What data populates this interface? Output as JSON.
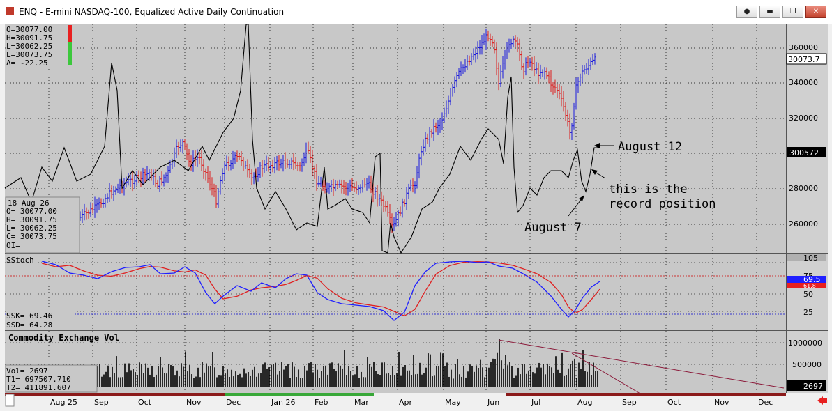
{
  "window": {
    "title": "ENQ - E-mini NASDAQ-100, Equalized Active Daily Continuation",
    "buttons": [
      "●",
      "▬",
      "❐",
      "✕"
    ]
  },
  "ohlc_box": {
    "open": "O=30077.00",
    "high": "H=30091.75",
    "low1": "L=30062.25",
    "low2": "L=30073.75",
    "delta": "Δ=  -22.25"
  },
  "data_window": {
    "date": "18 Aug 26",
    "o": "O=    30077.00",
    "h": "H=    30091.75",
    "l": "L=    30062.25",
    "c": "C=    30073.75",
    "oi": "OI="
  },
  "price_panel": {
    "ticks": [
      "360000",
      "340000",
      "320000",
      "300000",
      "280000",
      "260000"
    ],
    "last_price": "30073.7",
    "line_marker": "300572"
  },
  "annotations": {
    "aug12": "August 12",
    "record1": "this is the",
    "record2": "record position",
    "aug7": "August 7"
  },
  "stoch_panel": {
    "title": "SStoch",
    "ticks": [
      "105",
      "75",
      "50",
      "25"
    ],
    "marker_red": "61.8",
    "marker_blue": "69.5",
    "ssk": "SSK=   69.46",
    "ssd": "SSD=   64.28"
  },
  "volume_panel": {
    "title": "Commodity Exchange Vol",
    "ticks": [
      "1000000",
      "500000"
    ],
    "last": "2697",
    "vol": "Vol=          2697",
    "t1": "T1=    697507.710",
    "t2": "T2=    411891.607"
  },
  "time_axis": {
    "months": [
      "Aug 25",
      "Sep",
      "Oct",
      "Nov",
      "Dec",
      "Jan 26",
      "Feb",
      "Mar",
      "Apr",
      "May",
      "Jun",
      "Jul",
      "Aug",
      "Sep",
      "Oct",
      "Nov",
      "Dec"
    ]
  },
  "colors": {
    "up_bar": "#1a1adc",
    "down_bar": "#dc1e1e",
    "chart_bg": "#c8c8c8",
    "line": "#000000",
    "trendline": "#8b1a3a"
  },
  "chart_data": [
    {
      "type": "bar",
      "name": "E-mini NASDAQ-100 daily OHLC (up/down colored)",
      "x": [
        "Sep",
        "Oct",
        "Nov",
        "Dec",
        "Jan 26",
        "Feb",
        "Mar",
        "Apr",
        "May",
        "Jun",
        "Jul",
        "Aug"
      ],
      "close_approx": [
        272000,
        287000,
        294000,
        297000,
        294000,
        285000,
        282000,
        268000,
        335000,
        362000,
        344000,
        353000
      ],
      "yticks": [
        260000,
        280000,
        300000,
        320000,
        340000,
        360000
      ],
      "last": 30073.75
    },
    {
      "type": "line",
      "name": "overlay line",
      "x": [
        "Sep",
        "Oct",
        "Nov",
        "Dec",
        "Jan 26",
        "Feb",
        "Mar",
        "Apr",
        "May",
        "Jun",
        "Jul",
        "Aug"
      ],
      "values_approx": [
        346000,
        272000,
        297000,
        287000,
        262000,
        259000,
        262000,
        255000,
        285000,
        298000,
        278000,
        300572
      ],
      "annotations": [
        "August 12",
        "this is the record position",
        "August 7"
      ]
    },
    {
      "type": "line",
      "name": "SStoch",
      "series": [
        "SSK",
        "SSD"
      ],
      "last": [
        69.46,
        64.28
      ],
      "ylim": [
        0,
        105
      ]
    },
    {
      "type": "bar",
      "name": "Commodity Exchange Vol",
      "last": 2697,
      "ylim": [
        0,
        1100000
      ]
    }
  ]
}
